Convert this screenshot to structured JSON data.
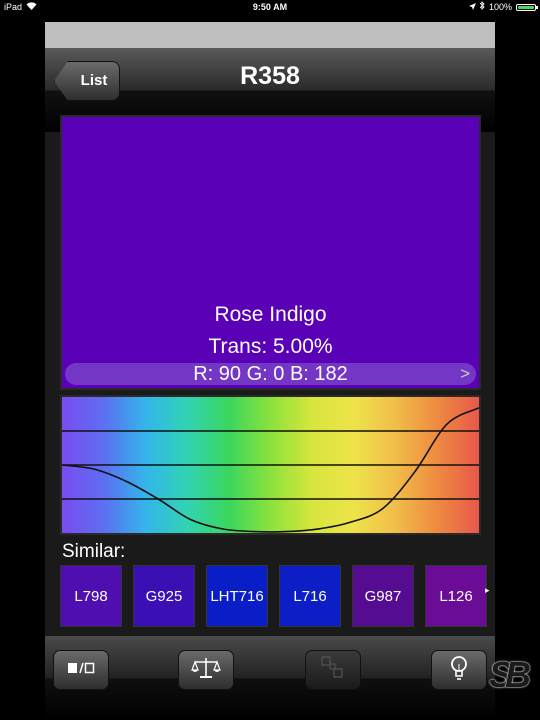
{
  "status_bar": {
    "device": "iPad",
    "time": "9:50 AM",
    "battery": "100%"
  },
  "nav": {
    "back_label": "List",
    "title": "R358"
  },
  "swatch": {
    "color": "#5a00b6",
    "name": "Rose Indigo",
    "trans": "Trans: 5.00%",
    "rgb": "R: 90 G: 0 B: 182",
    "chevron": ">"
  },
  "spectrum_curve": [
    0.5,
    0.47,
    0.38,
    0.25,
    0.1,
    0.03,
    0.01,
    0.01,
    0.03,
    0.08,
    0.18,
    0.45,
    0.8,
    0.92
  ],
  "similar": {
    "label": "Similar:",
    "items": [
      {
        "code": "L798",
        "color": "#4f0fb0"
      },
      {
        "code": "G925",
        "color": "#3a0fb4"
      },
      {
        "code": "LHT716",
        "color": "#0a1ec8"
      },
      {
        "code": "L716",
        "color": "#0d1ec6"
      },
      {
        "code": "G987",
        "color": "#560c92"
      },
      {
        "code": "L126",
        "color": "#6b0c96"
      }
    ]
  },
  "toolbar": {
    "toggle_icon": "swatch-toggle-icon",
    "compare_icon": "balance-scale-icon",
    "split_icon": "split-squares-icon",
    "idea_icon": "lightbulb-icon"
  },
  "watermark": "SB"
}
